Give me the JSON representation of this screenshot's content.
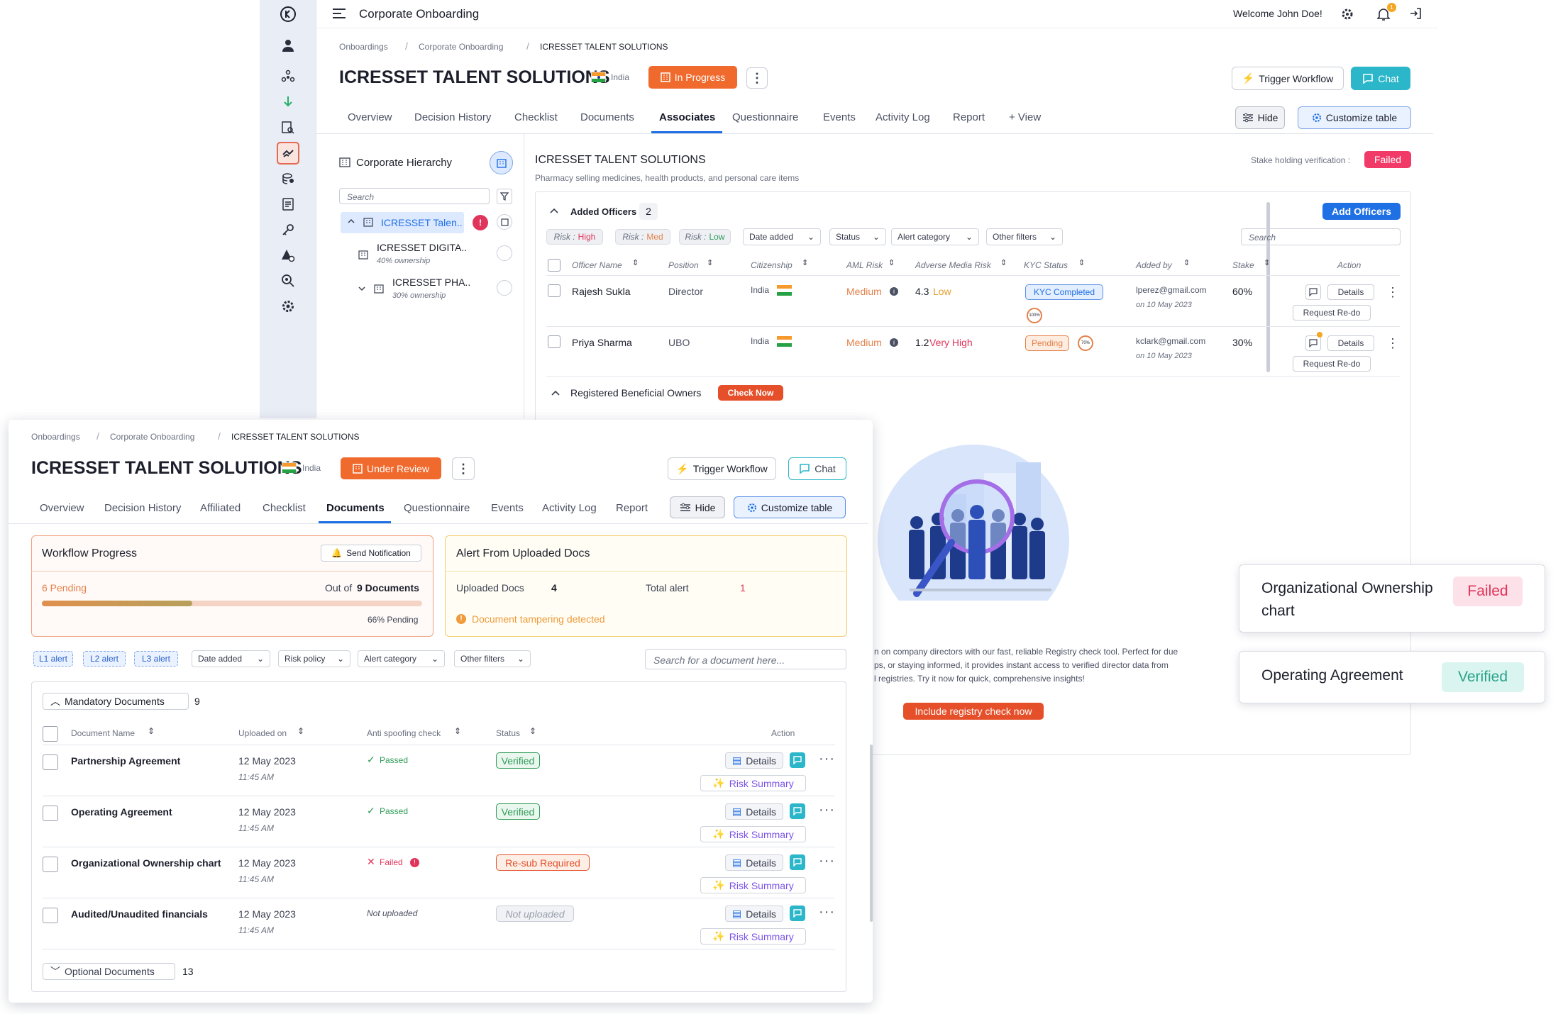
{
  "app": {
    "title": "Corporate Onboarding",
    "welcome": "Welcome John Doe!",
    "notif_count": "1"
  },
  "back": {
    "breadcrumb": [
      "Onboardings",
      "Corporate Onboarding",
      "ICRESSET TALENT SOLUTIONS"
    ],
    "company": "ICRESSET TALENT SOLUTIONS",
    "country": "India",
    "status": "In Progress",
    "trigger_label": "Trigger Workflow",
    "chat_label": "Chat",
    "tabs": [
      "Overview",
      "Decision History",
      "Checklist",
      "Documents",
      "Associates",
      "Questionnaire",
      "Events",
      "Activity Log",
      "Report",
      "+ View"
    ],
    "active_tab": "Associates",
    "hide_label": "Hide",
    "customize_label": "Customize table",
    "hierarchy": {
      "title": "Corporate Hierarchy",
      "search_placeholder": "Search",
      "root": "ICRESSET Talen..",
      "root_alert": "!",
      "children": [
        {
          "name": "ICRESSET DIGITA..",
          "ownership": "40% ownership"
        },
        {
          "name": "ICRESSET PHA..",
          "ownership": "30% ownership"
        }
      ]
    },
    "entity": {
      "name": "ICRESSET TALENT SOLUTIONS",
      "description": "Pharmacy selling medicines, health products, and personal care items",
      "stake_label": "Stake holding verification :",
      "stake_status": "Failed"
    },
    "officers": {
      "title": "Added Officers",
      "count": "2",
      "add_label": "Add Officers",
      "risk_chips": [
        {
          "label": "Risk :",
          "value": "High",
          "color": "#e0355a"
        },
        {
          "label": "Risk :",
          "value": "Med",
          "color": "#e4814a"
        },
        {
          "label": "Risk :",
          "value": "Low",
          "color": "#2e9b57"
        }
      ],
      "filters": [
        "Date added",
        "Status",
        "Alert category",
        "Other filters"
      ],
      "search_placeholder": "Search",
      "columns": [
        "Officer Name",
        "Position",
        "Citizenship",
        "AML Risk",
        "Adverse Media Risk",
        "KYC Status",
        "Added by",
        "Stake",
        "Action"
      ],
      "rows": [
        {
          "name": "Rajesh Sukla",
          "position": "Director",
          "citizenship": "India",
          "aml": "Medium",
          "adverse_score": "4.3",
          "adverse_level": "Low",
          "kyc": "KYC Completed",
          "kyc_pct": "100%",
          "added_by": "lperez@gmail.com",
          "added_on": "on 10 May 2023",
          "stake": "60%",
          "details": "Details",
          "redo": "Request Re-do"
        },
        {
          "name": "Priya Sharma",
          "position": "UBO",
          "citizenship": "India",
          "aml": "Medium",
          "adverse_score": "1.2",
          "adverse_level": "Very High",
          "kyc": "Pending",
          "kyc_pct": "70%",
          "added_by": "kclark@gmail.com",
          "added_on": "on 10 May 2023",
          "stake": "30%",
          "details": "Details",
          "redo": "Request Re-do"
        }
      ]
    },
    "rbo": {
      "title": "Registered Beneficial Owners",
      "check_label": "Check Now",
      "text_lines": [
        "n on company directors with our fast, reliable Registry check tool. Perfect for due",
        "ps, or staying informed, it provides instant access to verified director data from",
        "l registries. Try it now for quick, comprehensive insights!"
      ],
      "include_label": "Include registry check now"
    }
  },
  "front": {
    "breadcrumb": [
      "Onboardings",
      "Corporate Onboarding",
      "ICRESSET TALENT SOLUTIONS"
    ],
    "company": "ICRESSET TALENT SOLUTIONS",
    "country": "India",
    "status": "Under Review",
    "trigger_label": "Trigger Workflow",
    "chat_label": "Chat",
    "tabs": [
      "Overview",
      "Decision History",
      "Affiliated",
      "Checklist",
      "Documents",
      "Questionnaire",
      "Events",
      "Activity Log",
      "Report"
    ],
    "active_tab": "Documents",
    "hide_label": "Hide",
    "customize_label": "Customize table",
    "workflow": {
      "title": "Workflow Progress",
      "notify_label": "Send Notification",
      "pending": "6 Pending",
      "out_of": "Out of",
      "total": "9 Documents",
      "progress_pct": 66,
      "progress_label": "66% Pending"
    },
    "alerts": {
      "title": "Alert From Uploaded Docs",
      "uploaded_label": "Uploaded Docs",
      "uploaded_value": "4",
      "total_label": "Total alert",
      "total_value": "1",
      "warning": "Document tampering detected"
    },
    "chips": [
      "L1 alert",
      "L2 alert",
      "L3 alert"
    ],
    "filters": [
      "Date added",
      "Risk policy",
      "Alert category",
      "Other filters"
    ],
    "search_placeholder": "Search for a document here...",
    "mandatory": {
      "title": "Mandatory Documents",
      "count": "9"
    },
    "columns": [
      "Document Name",
      "Uploaded on",
      "Anti spoofing check",
      "Status",
      "Action"
    ],
    "docs": [
      {
        "name": "Partnership Agreement",
        "date": "12 May 2023",
        "time": "11:45 AM",
        "check": "Passed",
        "status": "Verified"
      },
      {
        "name": "Operating Agreement",
        "date": "12 May 2023",
        "time": "11:45 AM",
        "check": "Passed",
        "status": "Verified"
      },
      {
        "name": "Organizational Ownership chart",
        "date": "12 May 2023",
        "time": "11:45 AM",
        "check": "Failed",
        "status": "Re-sub Required"
      },
      {
        "name": "Audited/Unaudited financials",
        "date": "12 May 2023",
        "time": "11:45 AM",
        "check": "Not uploaded",
        "status": "Not uploaded"
      }
    ],
    "details_label": "Details",
    "risk_label": "Risk Summary",
    "optional": {
      "title": "Optional Documents",
      "count": "13"
    }
  },
  "callouts": [
    {
      "name": "Organizational Ownership chart",
      "status": "Failed"
    },
    {
      "name": "Operating Agreement",
      "status": "Verified"
    }
  ],
  "colors": {
    "accent": "#f06a2d",
    "blue": "#1f6fe5",
    "teal": "#2bb6c9",
    "failed": "#e0355a",
    "verified": "#2e9b57"
  }
}
